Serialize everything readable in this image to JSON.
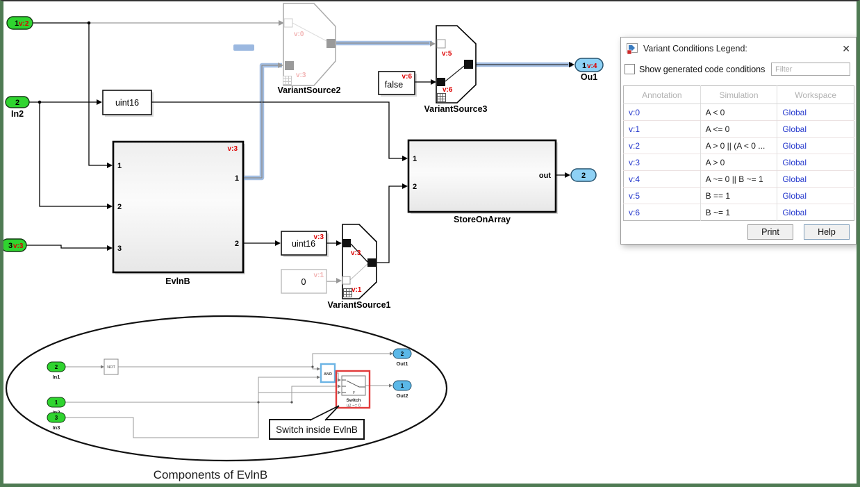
{
  "legend": {
    "title": "Variant Conditions Legend:",
    "close_icon": "✕",
    "checkbox_label": "Show generated code conditions",
    "filter_placeholder": "Filter",
    "columns": [
      "Annotation",
      "Simulation",
      "Workspace"
    ],
    "rows": [
      {
        "annotation": "v:0",
        "simulation": "A < 0",
        "workspace": "Global"
      },
      {
        "annotation": "v:1",
        "simulation": "A <= 0",
        "workspace": "Global"
      },
      {
        "annotation": "v:2",
        "simulation": "A > 0 || (A < 0 ...",
        "workspace": "Global"
      },
      {
        "annotation": "v:3",
        "simulation": "A > 0",
        "workspace": "Global"
      },
      {
        "annotation": "v:4",
        "simulation": "A ~= 0 || B ~= 1",
        "workspace": "Global"
      },
      {
        "annotation": "v:5",
        "simulation": "B == 1",
        "workspace": "Global"
      },
      {
        "annotation": "v:6",
        "simulation": "B ~= 1",
        "workspace": "Global"
      }
    ],
    "print_label": "Print",
    "help_label": "Help"
  },
  "diagram": {
    "colors": {
      "variant_red": "#dd0000",
      "faded_red": "#f2b4b4",
      "highlight_blue": "#9bb8e0",
      "port_green": "#2fd42f",
      "port_blue": "#8ed1f5"
    },
    "ports": {
      "in1": {
        "number": "1",
        "variant": "v:2"
      },
      "in2": {
        "number": "2",
        "label": "In2"
      },
      "in3": {
        "number": "3",
        "variant": "v:3"
      },
      "ou1": {
        "number": "1",
        "variant": "v:4",
        "label": "Ou1"
      },
      "out2": {
        "number": "2"
      }
    },
    "blocks": {
      "uint16_top": {
        "label": "uint16"
      },
      "uint16_mid": {
        "label": "uint16",
        "variant": "v:3"
      },
      "zero": {
        "label": "0",
        "variant": "v:1"
      },
      "false_const": {
        "label": "false",
        "variant": "v:6"
      },
      "evlnb": {
        "label": "EvlnB",
        "variant": "v:3",
        "in1": "1",
        "in2": "2",
        "in3": "3",
        "out1": "1",
        "out2": "2"
      },
      "store": {
        "label": "StoreOnArray",
        "in1": "1",
        "in2": "2",
        "out": "out"
      },
      "vs1": {
        "label": "VariantSource1",
        "top_variant": "v:3",
        "bottom_variant": "v:1"
      },
      "vs2": {
        "label": "VariantSource2",
        "top_variant": "v:0",
        "bottom_variant": "v:3"
      },
      "vs3": {
        "label": "VariantSource3",
        "top_variant": "v:5",
        "bottom_variant": "v:6"
      }
    }
  },
  "inset": {
    "caption": "Components of EvlnB",
    "callout": "Switch inside EvlnB",
    "ports": {
      "in1": {
        "number": "2",
        "label": "In1"
      },
      "in2": {
        "number": "1",
        "label": "In2"
      },
      "in3": {
        "number": "3",
        "label": "In3"
      },
      "out1": {
        "number": "2",
        "label": "Out1"
      },
      "out2": {
        "number": "1",
        "label": "Out2"
      }
    },
    "blocks": {
      "not_gate": "NOT",
      "and_gate": "AND",
      "switch": "Switch",
      "switch_criteria": "u2 ~= 0"
    }
  }
}
